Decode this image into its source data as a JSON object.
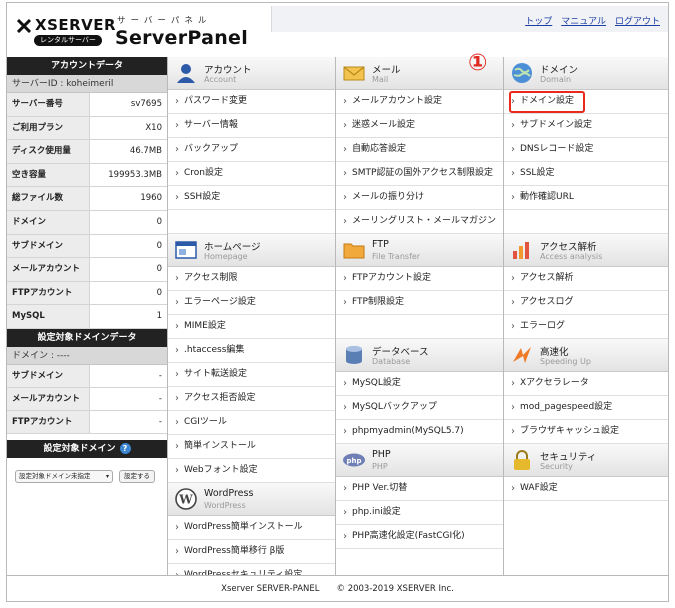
{
  "header": {
    "brand": "XSERVER",
    "badge": "レンタルサーバー",
    "kana": "サーバーパネル",
    "title": "ServerPanel",
    "nav": [
      "トップ",
      "マニュアル",
      "ログアウト"
    ]
  },
  "account": {
    "heading": "アカウントデータ",
    "server_id": "サーバーID : koheimeril",
    "rows": [
      {
        "k": "サーバー番号",
        "v": "sv7695"
      },
      {
        "k": "ご利用プラン",
        "v": "X10"
      },
      {
        "k": "ディスク使用量",
        "v": "46.7MB"
      },
      {
        "k": "空き容量",
        "v": "199953.3MB"
      },
      {
        "k": "総ファイル数",
        "v": "1960"
      },
      {
        "k": "ドメイン",
        "v": "0"
      },
      {
        "k": "サブドメイン",
        "v": "0"
      },
      {
        "k": "メールアカウント",
        "v": "0"
      },
      {
        "k": "FTPアカウント",
        "v": "0"
      },
      {
        "k": "MySQL",
        "v": "1"
      }
    ]
  },
  "target_domain": {
    "heading": "設定対象ドメインデータ",
    "domain": "ドメイン : ----",
    "rows": [
      {
        "k": "サブドメイン",
        "v": "-"
      },
      {
        "k": "メールアカウント",
        "v": "-"
      },
      {
        "k": "FTPアカウント",
        "v": "-"
      }
    ],
    "selector_heading": "設定対象ドメイン",
    "help": "?",
    "select_value": "設定対象ドメイン未指定",
    "button": "設定する"
  },
  "sections": {
    "account": {
      "t1": "アカウント",
      "t2": "Account",
      "items": [
        "パスワード変更",
        "サーバー情報",
        "バックアップ",
        "Cron設定",
        "SSH設定"
      ]
    },
    "mail": {
      "t1": "メール",
      "t2": "Mail",
      "items": [
        "メールアカウント設定",
        "迷惑メール設定",
        "自動応答設定",
        "SMTP認証の国外アクセス制限設定",
        "メールの振り分け",
        "メーリングリスト・メールマガジン"
      ]
    },
    "domain": {
      "t1": "ドメイン",
      "t2": "Domain",
      "items": [
        "ドメイン設定",
        "サブドメイン設定",
        "DNSレコード設定",
        "SSL設定",
        "動作確認URL"
      ]
    },
    "homepage": {
      "t1": "ホームページ",
      "t2": "Homepage",
      "items": [
        "アクセス制限",
        "エラーページ設定",
        "MIME設定",
        ".htaccess編集",
        "サイト転送設定",
        "アクセス拒否設定",
        "CGIツール",
        "簡単インストール",
        "Webフォント設定"
      ]
    },
    "ftp": {
      "t1": "FTP",
      "t2": "File Transfer",
      "items": [
        "FTPアカウント設定",
        "FTP制限設定"
      ]
    },
    "access": {
      "t1": "アクセス解析",
      "t2": "Access analysis",
      "items": [
        "アクセス解析",
        "アクセスログ",
        "エラーログ"
      ]
    },
    "database": {
      "t1": "データベース",
      "t2": "Database",
      "items": [
        "MySQL設定",
        "MySQLバックアップ",
        "phpmyadmin(MySQL5.7)"
      ]
    },
    "speed": {
      "t1": "高速化",
      "t2": "Speeding Up",
      "items": [
        "Xアクセラレータ",
        "mod_pagespeed設定",
        "ブラウザキャッシュ設定"
      ]
    },
    "php": {
      "t1": "PHP",
      "t2": "PHP",
      "items": [
        "PHP Ver.切替",
        "php.ini設定",
        "PHP高速化設定(FastCGI化)"
      ]
    },
    "security": {
      "t1": "セキュリティ",
      "t2": "Security",
      "items": [
        "WAF設定"
      ]
    },
    "wordpress": {
      "t1": "WordPress",
      "t2": "WordPress",
      "items": [
        "WordPress簡単インストール",
        "WordPress簡単移行 β版",
        "WordPressセキュリティ設定"
      ]
    }
  },
  "annotation": "①",
  "footer": "Xserver SERVER-PANEL　　© 2003-2019 XSERVER Inc.",
  "colors": {
    "highlight": "#e8291c",
    "link": "#1d3fa3"
  }
}
